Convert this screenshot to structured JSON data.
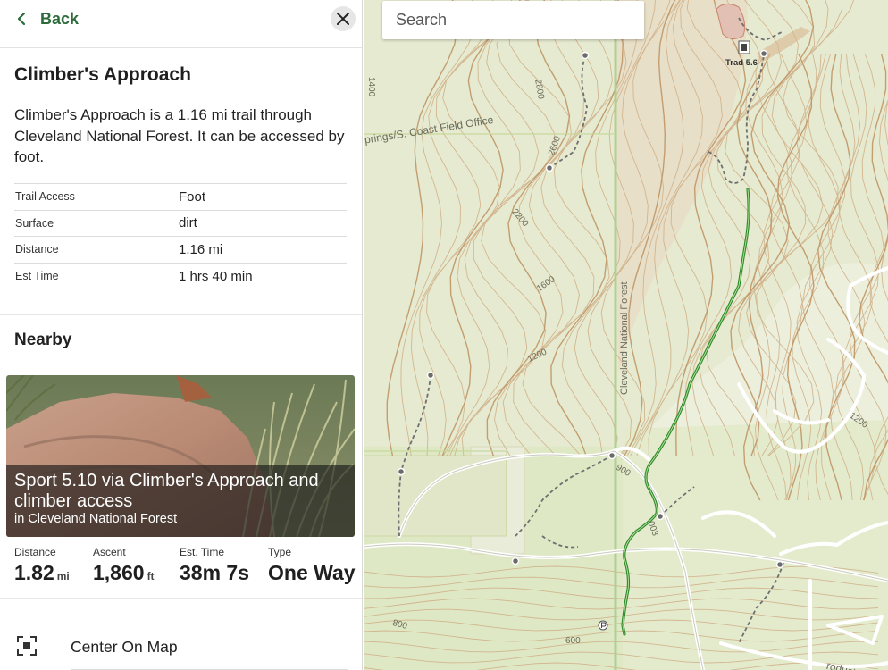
{
  "header": {
    "back_label": "Back"
  },
  "trail": {
    "title": "Climber's Approach",
    "description": "Climber's Approach is a 1.16 mi trail through Cleveland National Forest. It can be accessed by foot.",
    "attributes": [
      {
        "key": "Trail Access",
        "value": "Foot"
      },
      {
        "key": "Surface",
        "value": "dirt"
      },
      {
        "key": "Distance",
        "value": "1.16 mi"
      },
      {
        "key": "Est Time",
        "value": "1 hrs 40 min"
      }
    ]
  },
  "nearby": {
    "title": "Nearby",
    "card": {
      "name": "Sport 5.10 via Climber's Approach and climber access",
      "location": "in Cleveland National Forest"
    },
    "stats": [
      {
        "label": "Distance",
        "value": "1.82",
        "unit": "mi"
      },
      {
        "label": "Ascent",
        "value": "1,860",
        "unit": "ft"
      },
      {
        "label": "Est. Time",
        "value": "38m 7s",
        "unit": ""
      },
      {
        "label": "Type",
        "value": "One Way",
        "unit": ""
      }
    ]
  },
  "actions": {
    "center_on_map": "Center On Map"
  },
  "map": {
    "search_placeholder": "Search",
    "labels": {
      "springs_office": "Springs/S. Coast Field Office",
      "forest_name": "Cleveland National Forest",
      "trad_marker": "Trad 5.6",
      "road_name": "roduct Rd",
      "route_number": "003",
      "elev_2800": "2800",
      "elev_2600": "2600",
      "elev_2200": "2200",
      "elev_1600": "1600",
      "elev_1400": "1400",
      "elev_1200_a": "1200",
      "elev_1200_b": "1200",
      "elev_900": "900",
      "elev_800": "800",
      "elev_600": "600"
    },
    "colors": {
      "trail": "#2e8b2e",
      "contour": "#c9a57a",
      "vegetation": "#dde8c0",
      "road": "#ffffff"
    }
  }
}
